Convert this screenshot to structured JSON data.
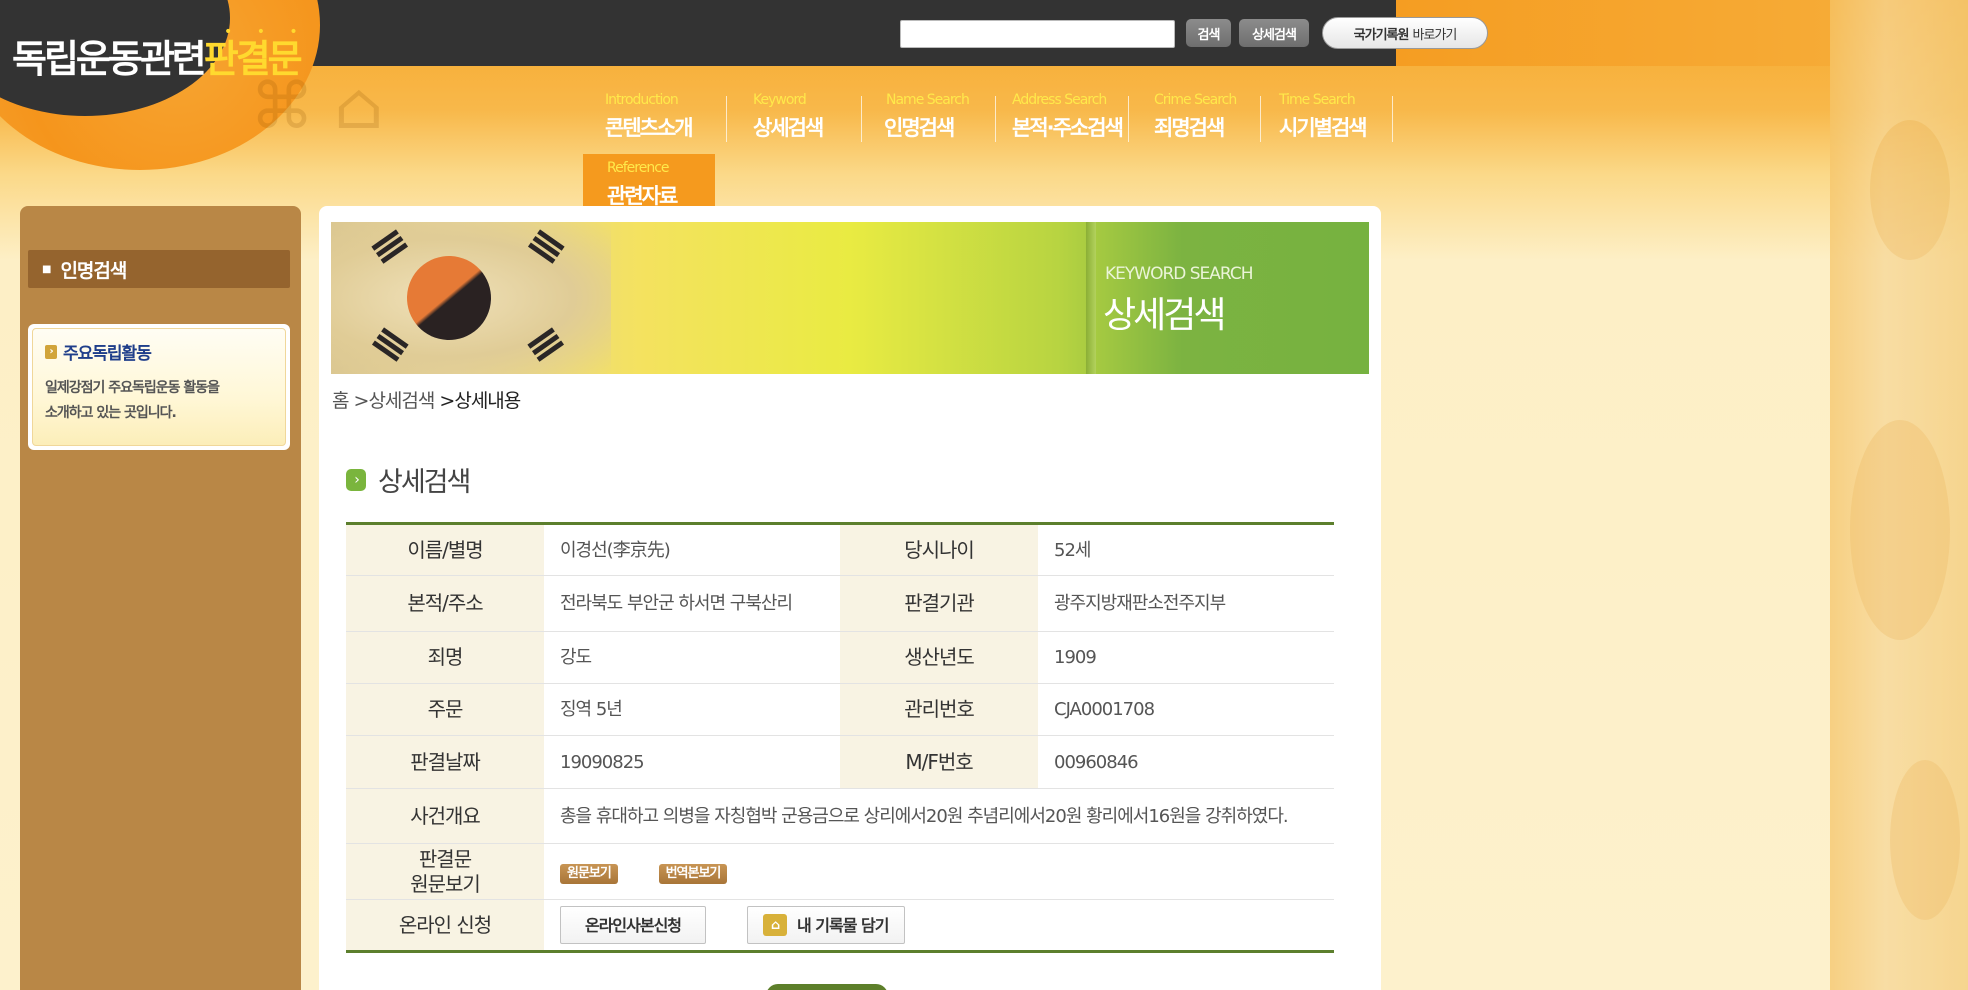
{
  "site": {
    "logo_main": "독립운동관련",
    "logo_accent": "판결문",
    "logo_dots": "• • •"
  },
  "top": {
    "search_placeholder": "",
    "search_button": "검색",
    "detail_search_button": "상세검색",
    "archive_button_bold": "국가기록원",
    "archive_button_light": "바로가기"
  },
  "nav": {
    "items": [
      {
        "en": "Introduction",
        "ko": "콘텐츠소개"
      },
      {
        "en": "Keyword",
        "ko": "상세검색"
      },
      {
        "en": "Name Search",
        "ko": "인명검색"
      },
      {
        "en": "Address Search",
        "ko": "본적·주소검색"
      },
      {
        "en": "Crime Search",
        "ko": "죄명검색"
      },
      {
        "en": "Time Search",
        "ko": "시기별검색"
      }
    ],
    "reference": {
      "en": "Reference",
      "ko": "관련자료"
    }
  },
  "sidebar": {
    "menu_item": "인명검색",
    "box_title": "주요독립활동",
    "box_desc_line1": "일제강점기 주요독립운동 활동을",
    "box_desc_line2": "소개하고 있는 곳입니다."
  },
  "banner": {
    "en": "KEYWORD SEARCH",
    "ko": "상세검색"
  },
  "breadcrumb": {
    "home": "홈",
    "level1": ">상세검색",
    "current": ">상세내용"
  },
  "section": {
    "title": "상세검색"
  },
  "detail": {
    "name_label": "이름/별명",
    "name_value": "이경선(李京先)",
    "age_label": "당시나이",
    "age_value": "52세",
    "address_label": "본적/주소",
    "address_value": "전라북도 부안군 하서면 구북산리",
    "court_label": "판결기관",
    "court_value": "광주지방재판소전주지부",
    "crime_label": "죄명",
    "crime_value": "강도",
    "year_label": "생산년도",
    "year_value": "1909",
    "sentence_label": "주문",
    "sentence_value": "징역 5년",
    "mgmt_label": "관리번호",
    "mgmt_value": "CJA0001708",
    "date_label": "판결날짜",
    "date_value": "19090825",
    "mf_label": "M/F번호",
    "mf_value": "00960846",
    "summary_label": "사건개요",
    "summary_value": "총을 휴대하고 의병을 자칭협박 군용금으로 상리에서20원 추념리에서20원 황리에서16원을 강취하였다.",
    "original_label_line1": "판결문",
    "original_label_line2": "원문보기",
    "view_original_button": "원문보기",
    "view_translation_button": "번역본보기",
    "online_label": "온라인 신청",
    "copy_request_button": "온라인사본신청",
    "my_records_button": "내 기록물 담기"
  },
  "colors": {
    "header_dark": "#333333",
    "orange": "#f59d22",
    "sidebar": "#b98746",
    "green": "#5c7f2d",
    "table_header": "#f8f3e3"
  }
}
